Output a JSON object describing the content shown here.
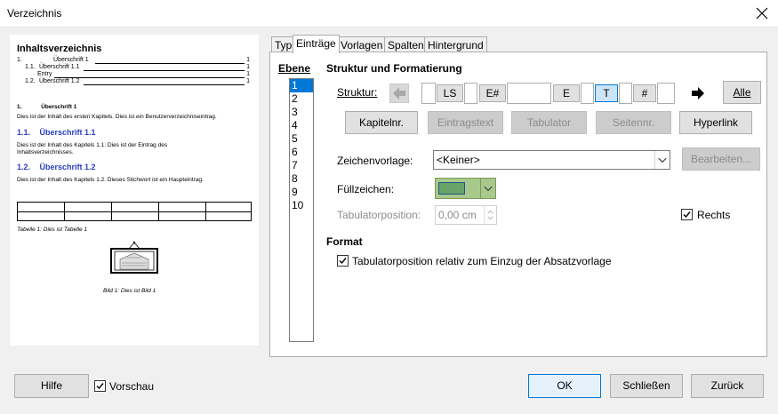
{
  "window": {
    "title": "Verzeichnis"
  },
  "preview": {
    "title": "Inhaltsverzeichnis",
    "toc": [
      {
        "num": "1.",
        "text": "Überschrift 1",
        "page": "1"
      },
      {
        "num": "1.1.",
        "text": "Überschrift 1.1",
        "page": "1"
      },
      {
        "num": "",
        "text": "Entry",
        "page": "1"
      },
      {
        "num": "1.2.",
        "text": "Überschrift 1.2",
        "page": "1"
      }
    ],
    "h1_num": "1.",
    "h1_text": "Überschrift 1",
    "p1": "Dies ist der Inhalt des ersten Kapitels. Dies ist ein Benutzerverzeichniseintrag.",
    "h11_num": "1.1.",
    "h11_text": "Überschrift 1.1",
    "p2a": "Dies ist der Inhalt des Kapitels 1.1. Dies ist der Eintrag des",
    "p2b": "Inhaltsverzeichnisses.",
    "h12_num": "1.2.",
    "h12_text": "Überschrift 1.2",
    "p3": "Dies ist der Inhalt des Kapitels 1.2. Dieses Stichwort ist ein Haupteintrag.",
    "table_caption": "Tabelle 1: Dies ist Tabelle 1",
    "image_caption": "Bild 1: Dies ist Bild 1"
  },
  "tabs": [
    "Typ",
    "Einträge",
    "Vorlagen",
    "Spalten",
    "Hintergrund"
  ],
  "active_tab": "Einträge",
  "levels": {
    "label": "Ebene",
    "items": [
      "1",
      "2",
      "3",
      "4",
      "5",
      "6",
      "7",
      "8",
      "9",
      "10"
    ],
    "selected": "1"
  },
  "struktur": {
    "heading": "Struktur und Formatierung",
    "label": "Struktur:",
    "tokens": [
      "LS",
      "E#",
      "E",
      "T",
      "#"
    ],
    "selected_token": "T",
    "all_button": "Alle"
  },
  "insert_buttons": {
    "kapitelnr": "Kapitelnr.",
    "eintragstext": "Eintragstext",
    "tabulator": "Tabulator",
    "seitennr": "Seitennr.",
    "hyperlink": "Hyperlink"
  },
  "zeichenvorlage": {
    "label": "Zeichenvorlage:",
    "value": "<Keiner>",
    "edit_button": "Bearbeiten..."
  },
  "fuellzeichen": {
    "label": "Füllzeichen:"
  },
  "tabulatorposition": {
    "label": "Tabulatorposition:",
    "value": "0,00 cm"
  },
  "rechts": {
    "label": "Rechts",
    "checked": true
  },
  "format": {
    "heading": "Format",
    "relative_label": "Tabulatorposition relativ zum Einzug der Absatzvorlage",
    "relative_checked": true
  },
  "footer": {
    "help": "Hilfe",
    "preview_label": "Vorschau",
    "preview_checked": true,
    "ok": "OK",
    "close": "Schließen",
    "back": "Zurück"
  }
}
